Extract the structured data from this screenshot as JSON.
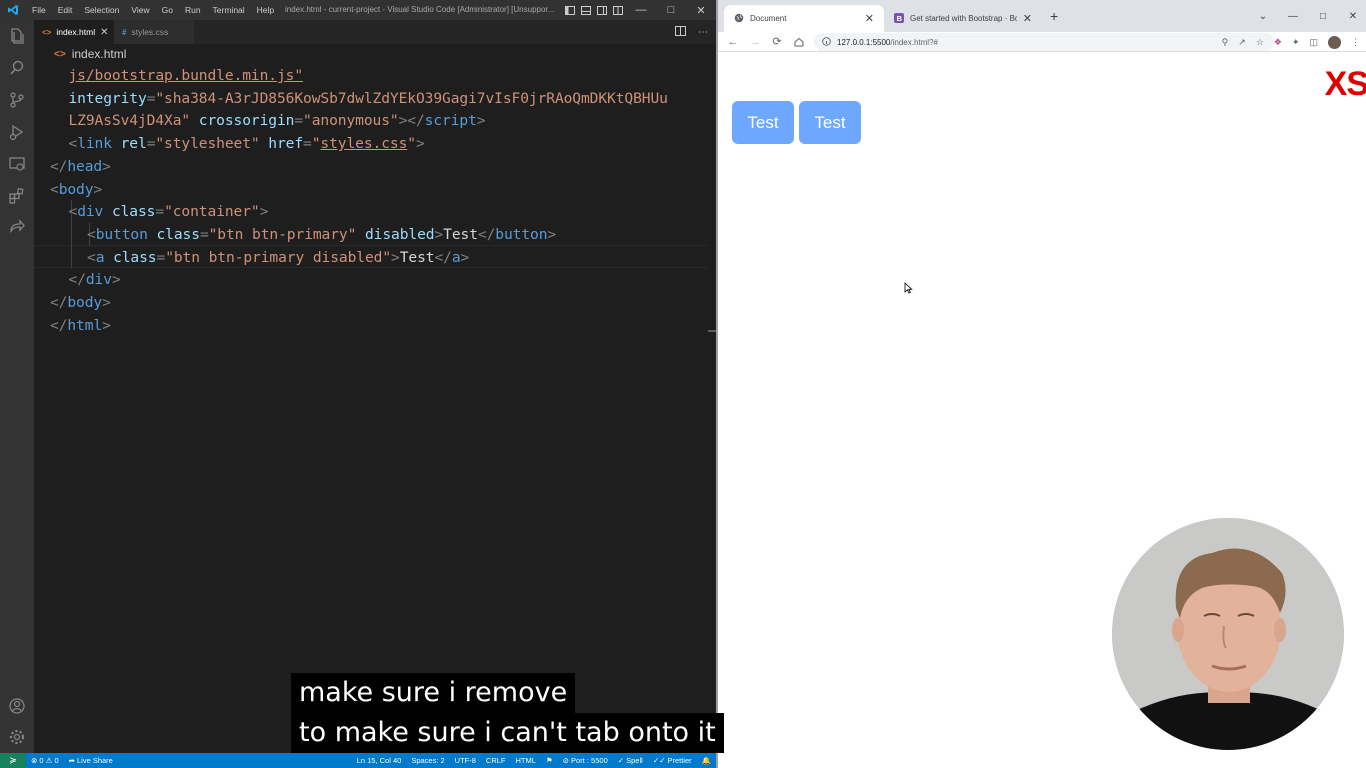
{
  "vscode": {
    "menu": [
      "File",
      "Edit",
      "Selection",
      "View",
      "Go",
      "Run",
      "Terminal",
      "Help"
    ],
    "window_title": "index.html - current-project - Visual Studio Code [Administrator] [Unsuppor...",
    "tabs": [
      {
        "label": "index.html",
        "icon": "html-file-icon",
        "active": true
      },
      {
        "label": "styles.css",
        "icon": "css-file-icon",
        "active": false
      }
    ],
    "breadcrumb": "index.html",
    "code_lines": [
      {
        "indent": 1,
        "tokens": [
          [
            "str link",
            "js/bootstrap.bundle.min.js\""
          ]
        ]
      },
      {
        "indent": 1,
        "tokens": [
          [
            "attr",
            "integrity"
          ],
          [
            "punc",
            "="
          ],
          [
            "str",
            "\"sha384-A3rJD856KowSb7dwlZdYEkO39Gagi7vIsF0jrRAoQmDKKtQBHUu"
          ]
        ]
      },
      {
        "indent": 1,
        "tokens": [
          [
            "str",
            "LZ9AsSv4jD4Xa\""
          ],
          [
            "text",
            " "
          ],
          [
            "attr",
            "crossorigin"
          ],
          [
            "punc",
            "="
          ],
          [
            "str",
            "\"anonymous\""
          ],
          [
            "punc",
            "></"
          ],
          [
            "tag",
            "script"
          ],
          [
            "punc",
            ">"
          ]
        ]
      },
      {
        "indent": 1,
        "tokens": [
          [
            "punc",
            "<"
          ],
          [
            "tag",
            "link"
          ],
          [
            "text",
            " "
          ],
          [
            "attr",
            "rel"
          ],
          [
            "punc",
            "="
          ],
          [
            "str",
            "\"stylesheet\""
          ],
          [
            "text",
            " "
          ],
          [
            "attr",
            "href"
          ],
          [
            "punc",
            "="
          ],
          [
            "str",
            "\""
          ],
          [
            "str link",
            "styles.css"
          ],
          [
            "str",
            "\""
          ],
          [
            "punc",
            ">"
          ]
        ]
      },
      {
        "indent": 0,
        "tokens": [
          [
            "punc",
            "</"
          ],
          [
            "tag",
            "head"
          ],
          [
            "punc",
            ">"
          ]
        ]
      },
      {
        "indent": 0,
        "tokens": [
          [
            "punc",
            "<"
          ],
          [
            "tag",
            "body"
          ],
          [
            "punc",
            ">"
          ]
        ]
      },
      {
        "indent": 1,
        "tokens": [
          [
            "punc",
            "<"
          ],
          [
            "tag",
            "div"
          ],
          [
            "text",
            " "
          ],
          [
            "attr",
            "class"
          ],
          [
            "punc",
            "="
          ],
          [
            "str",
            "\"container\""
          ],
          [
            "punc",
            ">"
          ]
        ]
      },
      {
        "indent": 2,
        "tokens": [
          [
            "punc",
            "<"
          ],
          [
            "tag",
            "button"
          ],
          [
            "text",
            " "
          ],
          [
            "attr",
            "class"
          ],
          [
            "punc",
            "="
          ],
          [
            "str",
            "\"btn btn-primary\""
          ],
          [
            "text",
            " "
          ],
          [
            "attr",
            "disabled"
          ],
          [
            "punc",
            ">"
          ],
          [
            "text",
            "Test"
          ],
          [
            "punc",
            "</"
          ],
          [
            "tag",
            "button"
          ],
          [
            "punc",
            ">"
          ]
        ]
      },
      {
        "indent": 2,
        "tokens": [
          [
            "punc",
            "<"
          ],
          [
            "tag",
            "a"
          ],
          [
            "text",
            " "
          ],
          [
            "attr",
            "class"
          ],
          [
            "punc",
            "="
          ],
          [
            "str",
            "\"btn btn-primary disabled\""
          ],
          [
            "punc",
            ">"
          ],
          [
            "text",
            "Test"
          ],
          [
            "punc",
            "</"
          ],
          [
            "tag",
            "a"
          ],
          [
            "punc",
            ">"
          ]
        ]
      },
      {
        "indent": 1,
        "tokens": [
          [
            "punc",
            "</"
          ],
          [
            "tag",
            "div"
          ],
          [
            "punc",
            ">"
          ]
        ]
      },
      {
        "indent": 0,
        "tokens": [
          [
            "punc",
            "</"
          ],
          [
            "tag",
            "body"
          ],
          [
            "punc",
            ">"
          ]
        ]
      },
      {
        "indent": 0,
        "tokens": [
          [
            "punc",
            "</"
          ],
          [
            "tag",
            "html"
          ],
          [
            "punc",
            ">"
          ]
        ]
      }
    ],
    "status": {
      "errors": "0",
      "warnings": "0",
      "live_share": "Live Share",
      "position": "Ln 15, Col 40",
      "spaces": "Spaces: 2",
      "encoding": "UTF-8",
      "eol": "CRLF",
      "language": "HTML",
      "port": "Port : 5500",
      "spell": "Spell",
      "prettier": "Prettier"
    }
  },
  "browser": {
    "tabs": [
      {
        "label": "Document",
        "active": true
      },
      {
        "label": "Get started with Bootstrap · Boo",
        "active": false
      }
    ],
    "new_tab": "+",
    "url_host": "127.0.0.1:5500",
    "url_path": "/index.html?#",
    "page": {
      "buttons": [
        "Test",
        "Test"
      ],
      "breakpoint_label": "XS"
    }
  },
  "captions": [
    "make sure i remove",
    "to make sure i can't tab onto it"
  ],
  "colors": {
    "vscode_bg": "#1e1e1e",
    "statusbar": "#007acc",
    "bootstrap_disabled_primary": "#6ea8fe",
    "breakpoint_red": "#e00000"
  }
}
